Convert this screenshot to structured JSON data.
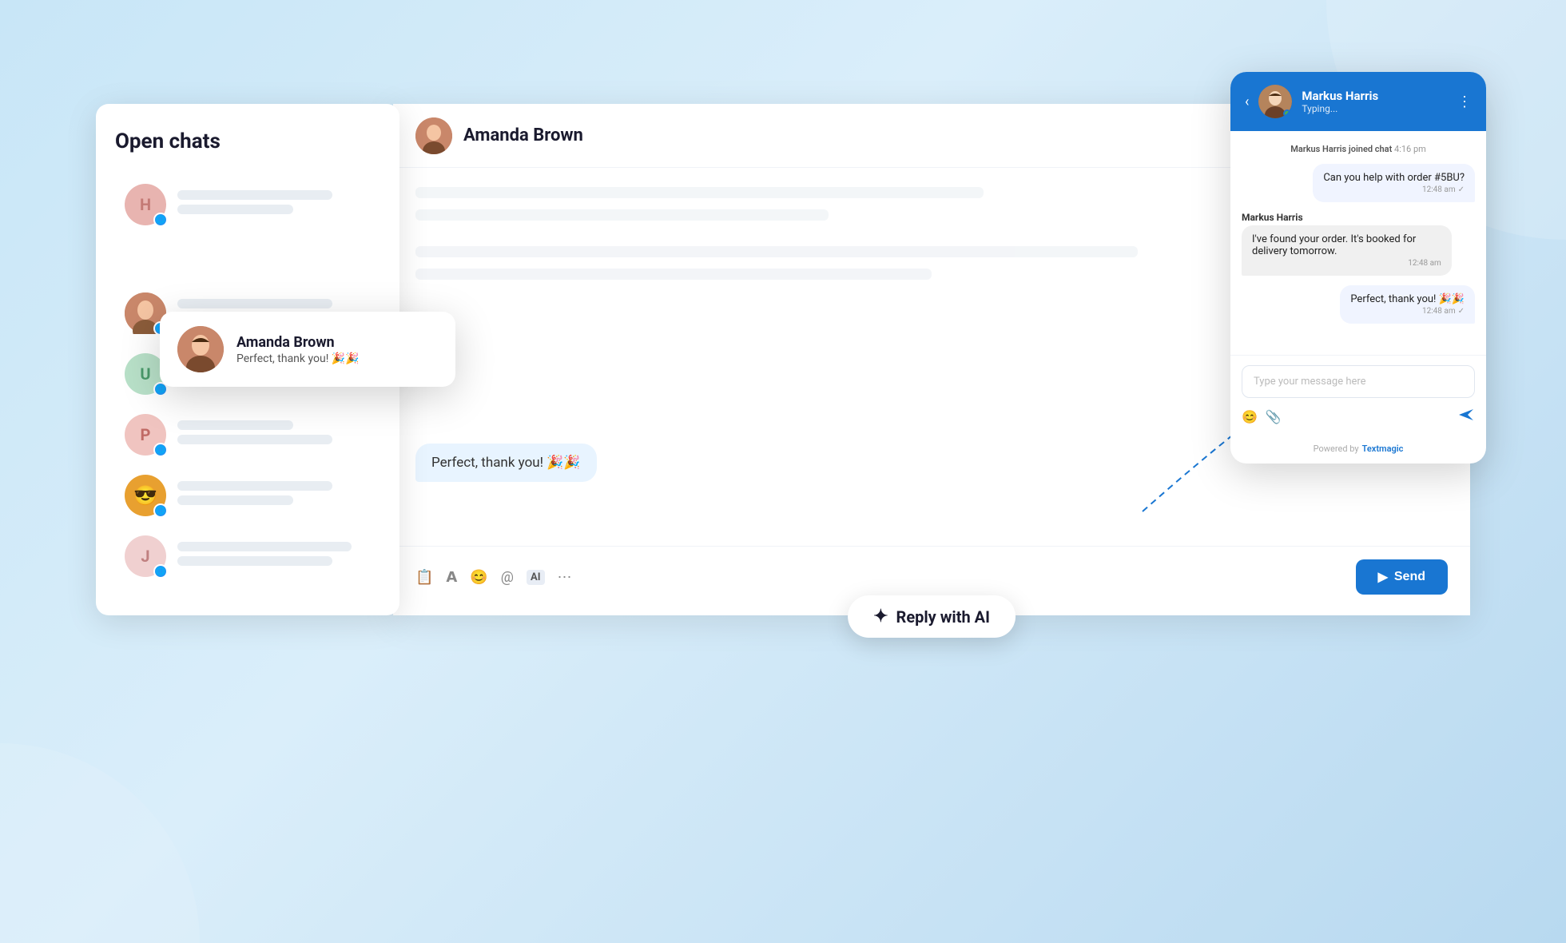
{
  "page": {
    "background": "#c8e6f7"
  },
  "open_chats": {
    "title": "Open chats",
    "items": [
      {
        "id": "h",
        "letter": "H",
        "color": "#e8b4b0",
        "text_color": "#c47a75"
      },
      {
        "id": "amanda",
        "name": "Amanda Brown",
        "preview": "Perfect, thank you! 🎉🎉",
        "hasPhoto": true
      },
      {
        "id": "u",
        "letter": "U",
        "color": "#b8e0c8",
        "text_color": "#4a9a6a"
      },
      {
        "id": "p",
        "letter": "P",
        "color": "#f0c4c0",
        "text_color": "#c06a65"
      },
      {
        "id": "photo1",
        "letter": "😎",
        "color": "#e8a030"
      },
      {
        "id": "j",
        "letter": "J",
        "color": "#f0d0d0",
        "text_color": "#c08080"
      }
    ]
  },
  "amanda_card": {
    "name": "Amanda Brown",
    "preview": "Perfect, thank you! 🎉🎉"
  },
  "chat_window": {
    "contact_name": "Amanda Brown",
    "messages": [
      {
        "type": "sent",
        "text": "Perfect, thank you! 🎉🎉",
        "time": ""
      }
    ],
    "toolbar": {
      "send_label": "Send"
    }
  },
  "mobile_chat": {
    "contact_name": "Markus Harris",
    "status": "Typing...",
    "system_message": "Markus Harris joined chat",
    "system_time": "4:16 pm",
    "messages": [
      {
        "type": "sent",
        "text": "Can you help with order #5BU?",
        "time": "12:48 am",
        "check": true
      },
      {
        "type": "agent",
        "agent_name": "Markus Harris",
        "text": "I've found your order. It's booked for delivery tomorrow.",
        "time": "12:48 am"
      },
      {
        "type": "sent",
        "text": "Perfect, thank you! 🎉🎉",
        "time": "12:48 am",
        "check": true
      }
    ],
    "input_placeholder": "Type your message here",
    "powered_by": "Powered by",
    "brand": "Textmagic"
  },
  "reply_ai": {
    "label": "Reply with AI"
  },
  "send_button": {
    "label": "Send"
  }
}
